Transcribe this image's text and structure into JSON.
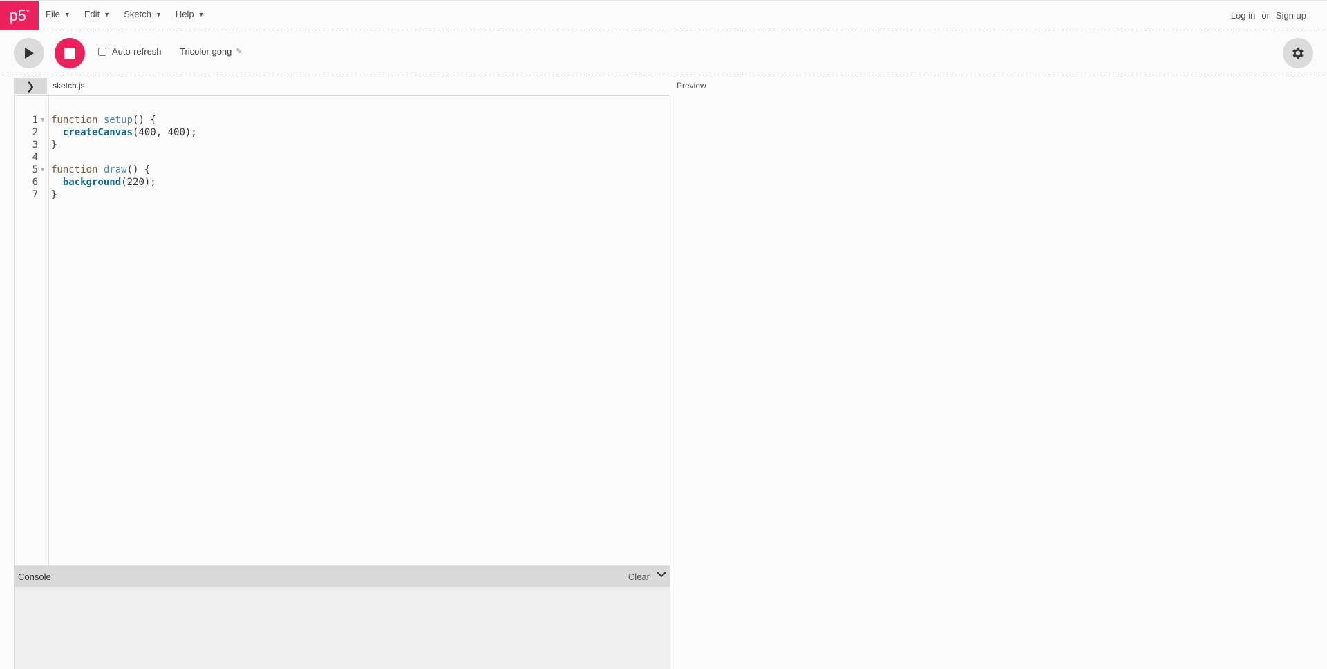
{
  "logo": {
    "text": "p5",
    "mark": "*"
  },
  "menu": [
    {
      "label": "File"
    },
    {
      "label": "Edit"
    },
    {
      "label": "Sketch"
    },
    {
      "label": "Help"
    }
  ],
  "auth": {
    "login": "Log in",
    "or": "or",
    "signup": "Sign up"
  },
  "toolbar": {
    "autorefresh_label": "Auto-refresh",
    "autorefresh_checked": false,
    "project_name": "Tricolor gong"
  },
  "editor": {
    "filename": "sketch.js",
    "preview_label": "Preview",
    "lines": [
      {
        "n": "1",
        "fold": true,
        "html": "<span class='kw'>function</span> <span class='fn'>setup</span>() {"
      },
      {
        "n": "2",
        "fold": false,
        "html": "  <span class='bi'>createCanvas</span>(400, 400);"
      },
      {
        "n": "3",
        "fold": false,
        "html": "}"
      },
      {
        "n": "4",
        "fold": false,
        "html": ""
      },
      {
        "n": "5",
        "fold": true,
        "html": "<span class='kw'>function</span> <span class='fn'>draw</span>() {"
      },
      {
        "n": "6",
        "fold": false,
        "html": "  <span class='bi'>background</span>(220);"
      },
      {
        "n": "7",
        "fold": false,
        "html": "}"
      }
    ]
  },
  "console": {
    "title": "Console",
    "clear_label": "Clear"
  },
  "colors": {
    "accent": "#ed225d",
    "button_gray": "#dbdbdb"
  }
}
